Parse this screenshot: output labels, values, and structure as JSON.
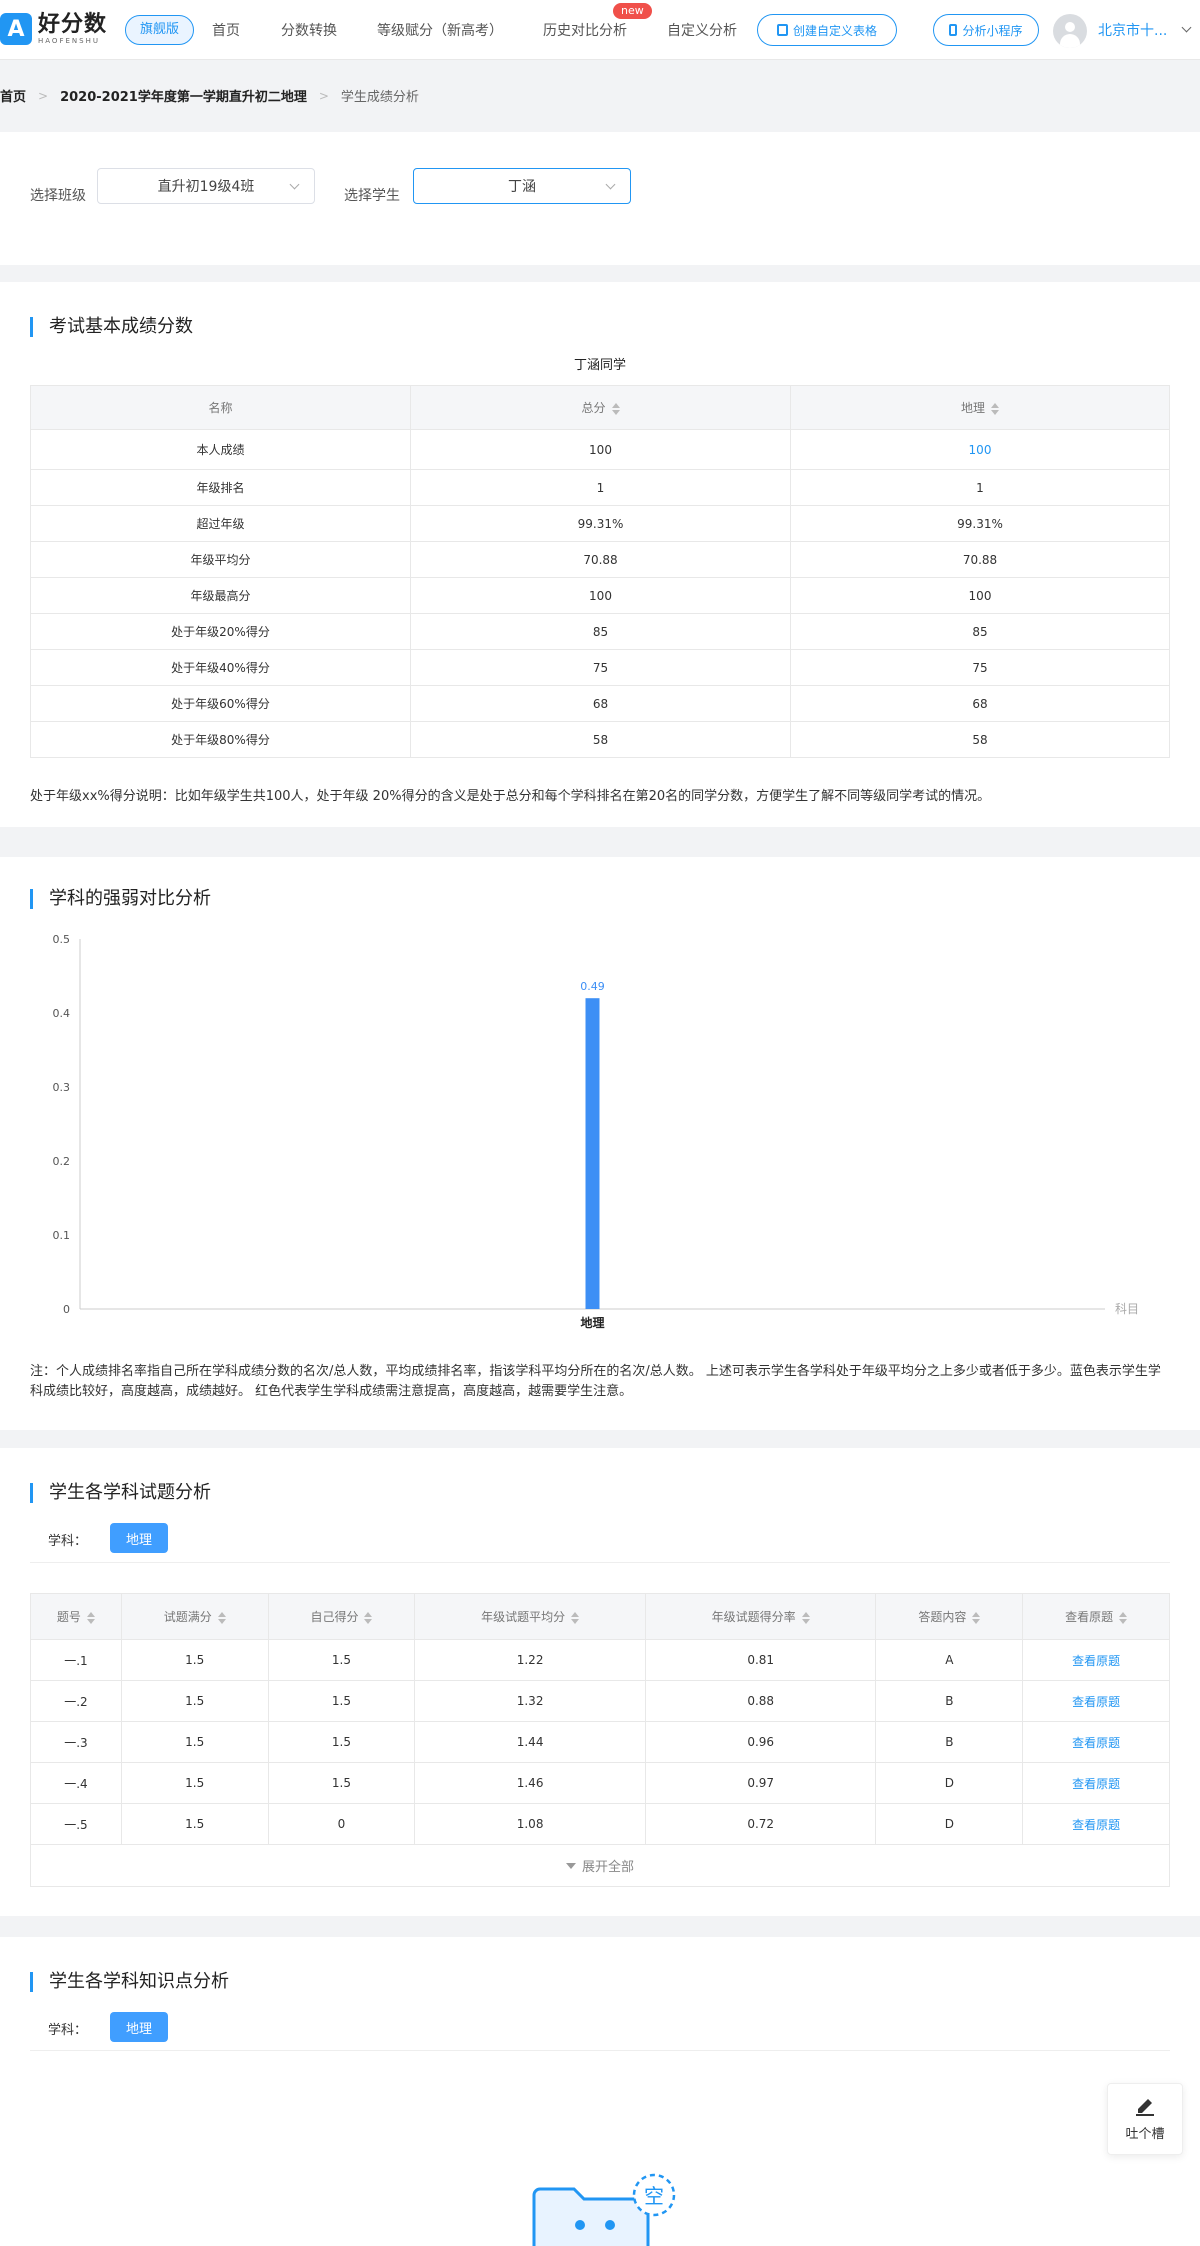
{
  "header": {
    "logo_cn": "好分数",
    "logo_en": "HAOFENSHU",
    "edition": "旗舰版",
    "nav": [
      "首页",
      "分数转换",
      "等级赋分（新高考）",
      "历史对比分析",
      "自定义分析"
    ],
    "new_tag": "new",
    "create_table": "创建自定义表格",
    "mini_program": "分析小程序",
    "user": "北京市十..."
  },
  "breadcrumb": [
    "首页",
    "2020-2021学年度第一学期直升初二地理",
    "学生成绩分析"
  ],
  "selectors": {
    "class_label": "选择班级",
    "class_value": "直升初19级4班",
    "student_label": "选择学生",
    "student_value": "丁涵"
  },
  "basic": {
    "title": "考试基本成绩分数",
    "caption": "丁涵同学",
    "headers": [
      "名称",
      "总分",
      "地理"
    ],
    "rows": [
      [
        "本人成绩",
        "100",
        "100"
      ],
      [
        "年级排名",
        "1",
        "1"
      ],
      [
        "超过年级",
        "99.31%",
        "99.31%"
      ],
      [
        "年级平均分",
        "70.88",
        "70.88"
      ],
      [
        "年级最高分",
        "100",
        "100"
      ],
      [
        "处于年级20%得分",
        "85",
        "85"
      ],
      [
        "处于年级40%得分",
        "75",
        "75"
      ],
      [
        "处于年级60%得分",
        "68",
        "68"
      ],
      [
        "处于年级80%得分",
        "58",
        "58"
      ]
    ],
    "note": "处于年级xx%得分说明：比如年级学生共100人，处于年级 20%得分的含义是处于总分和每个学科排名在第20名的同学分数，方便学生了解不同等级同学考试的情况。"
  },
  "compare": {
    "title": "学科的强弱对比分析",
    "note": "注：个人成绩排名率指自己所在学科成绩分数的名次/总人数，平均成绩排名率，指该学科平均分所在的名次/总人数。 上述可表示学生各学科处于年级平均分之上多少或者低于多少。蓝色表示学生学科成绩比较好，高度越高，成绩越好。 红色代表学生学科成绩需注意提高，高度越高，越需要学生注意。"
  },
  "chart_data": {
    "type": "bar",
    "categories": [
      "地理"
    ],
    "values": [
      0.42
    ],
    "data_labels": [
      "0.49"
    ],
    "xlabel": "科目",
    "ylabel": "",
    "ylim": [
      0,
      0.5
    ],
    "yticks": [
      "0",
      "0.1",
      "0.2",
      "0.3",
      "0.4",
      "0.5"
    ],
    "bar_color": "#3d8ff5",
    "grid": false
  },
  "questions": {
    "title": "学生各学科试题分析",
    "subject_label": "学科：",
    "subject": "地理",
    "headers": [
      "题号",
      "试题满分",
      "自己得分",
      "年级试题平均分",
      "年级试题得分率",
      "答题内容",
      "查看原题"
    ],
    "rows": [
      [
        "一.1",
        "1.5",
        "1.5",
        "1.22",
        "0.81",
        "A",
        "查看原题"
      ],
      [
        "一.2",
        "1.5",
        "1.5",
        "1.32",
        "0.88",
        "B",
        "查看原题"
      ],
      [
        "一.3",
        "1.5",
        "1.5",
        "1.44",
        "0.96",
        "B",
        "查看原题"
      ],
      [
        "一.4",
        "1.5",
        "1.5",
        "1.46",
        "0.97",
        "D",
        "查看原题"
      ],
      [
        "一.5",
        "1.5",
        "0",
        "1.08",
        "0.72",
        "D",
        "查看原题"
      ]
    ],
    "expand": "展开全部"
  },
  "knowledge": {
    "title": "学生各学科知识点分析",
    "subject_label": "学科：",
    "subject": "地理",
    "empty_glyph": "空"
  },
  "feedback": "吐个槽",
  "colors": {
    "accent": "#2196f3",
    "button": "#409eff"
  }
}
